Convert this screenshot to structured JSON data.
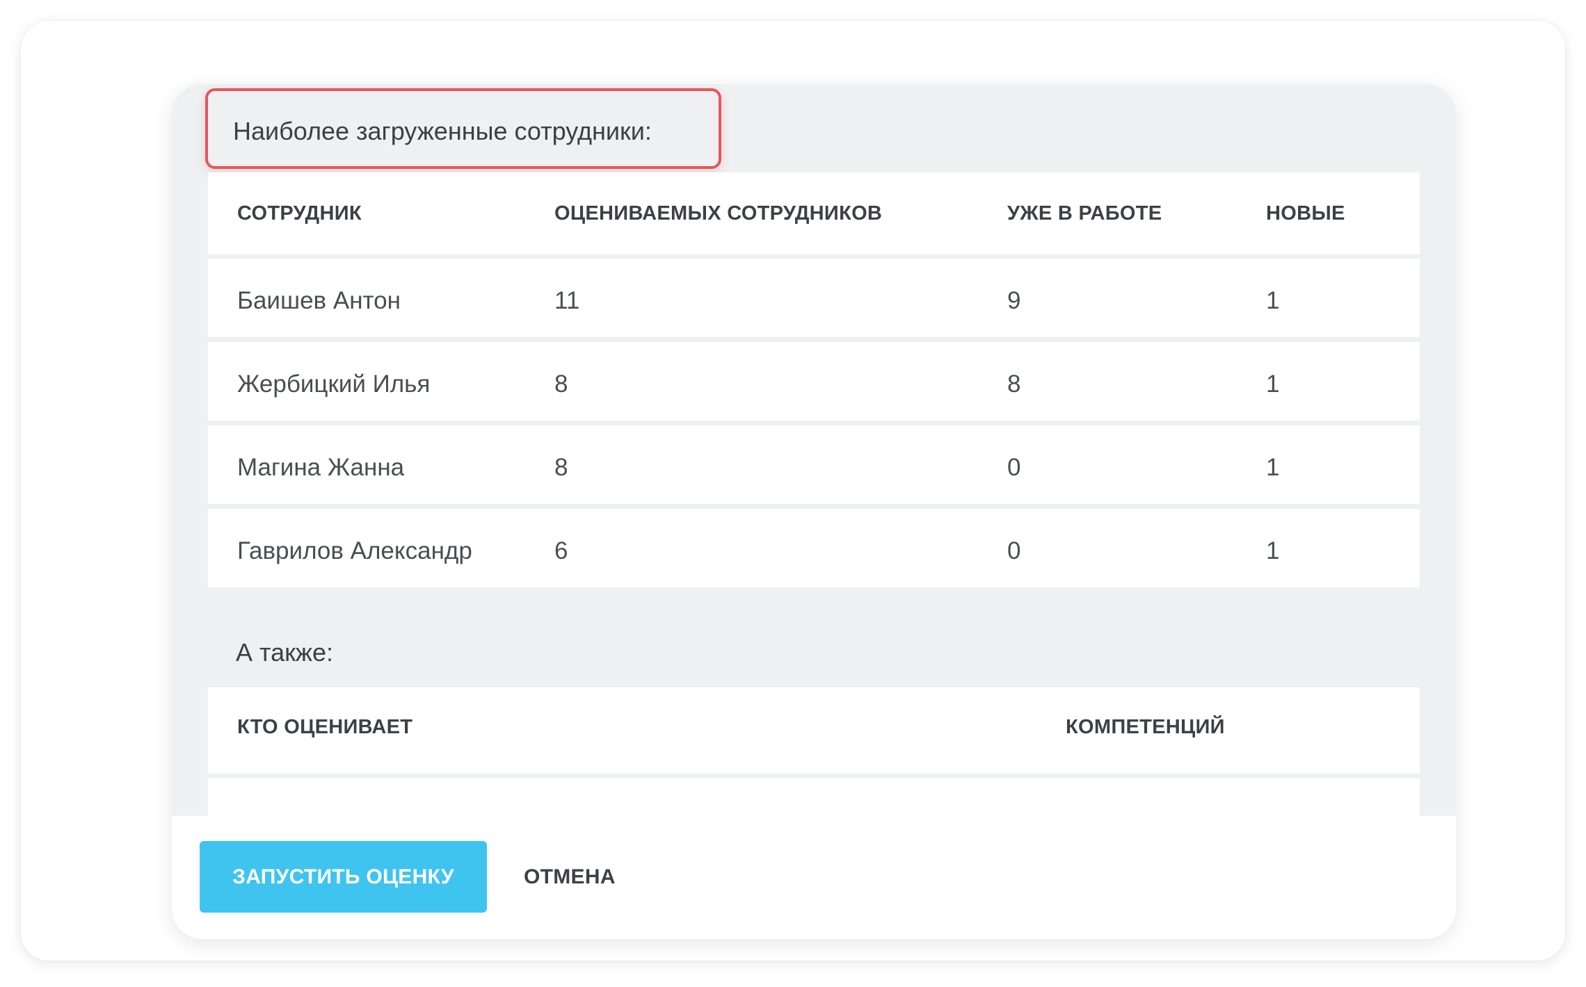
{
  "dialog": {
    "heading": "Наиболее загруженные сотрудники:",
    "workload_table": {
      "columns": [
        "СОТРУДНИК",
        "ОЦЕНИВАЕМЫХ СОТРУДНИКОВ",
        "УЖЕ В РАБОТЕ",
        "НОВЫЕ"
      ],
      "rows": [
        [
          "Баишев Антон",
          "11",
          "9",
          "1"
        ],
        [
          "Жербицкий Илья",
          "8",
          "8",
          "1"
        ],
        [
          "Магина Жанна",
          "8",
          "0",
          "1"
        ],
        [
          "Гаврилов Александр",
          "6",
          "0",
          "1"
        ]
      ]
    },
    "subheading": "А также:",
    "also_table": {
      "columns": [
        "КТО ОЦЕНИВАЕТ",
        "КОМПЕТЕНЦИЙ"
      ]
    },
    "footer": {
      "start_label": "ЗАПУСТИТЬ ОЦЕНКУ",
      "cancel_label": "ОТМЕНА"
    }
  },
  "colors": {
    "highlight_border": "#e8555c",
    "primary_button": "#3fc4f0",
    "dialog_background": "#eef0f2"
  }
}
